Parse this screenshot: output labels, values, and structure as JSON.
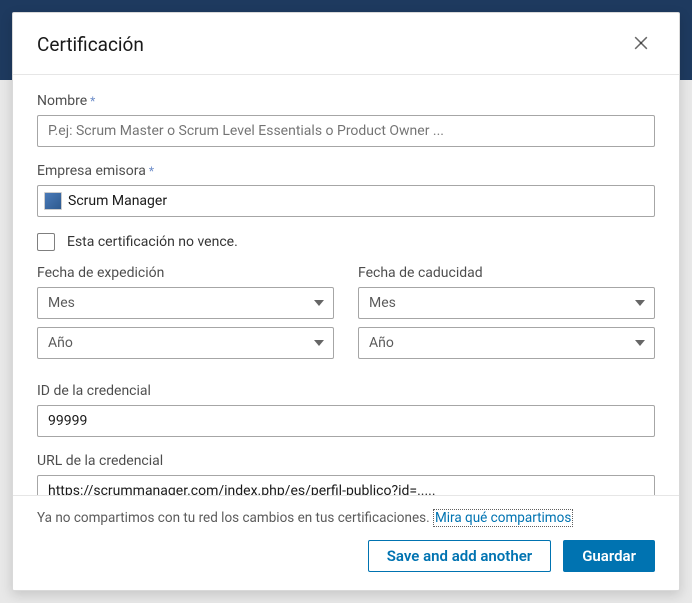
{
  "modal": {
    "title": "Certificación"
  },
  "fields": {
    "name": {
      "label": "Nombre",
      "placeholder": "P.ej: Scrum Master o Scrum Level Essentials o Product Owner ..."
    },
    "issuer": {
      "label": "Empresa emisora",
      "value": "Scrum Manager"
    },
    "no_expiry": {
      "label": "Esta certificación no vence."
    },
    "issue_date": {
      "label": "Fecha de expedición",
      "month": "Mes",
      "year": "Año"
    },
    "expiry_date": {
      "label": "Fecha de caducidad",
      "month": "Mes",
      "year": "Año"
    },
    "credential_id": {
      "label": "ID de la credencial",
      "value": "99999"
    },
    "credential_url": {
      "label": "URL de la credencial",
      "value": "https://scrummanager.com/index.php/es/perfil-publico?id=....."
    }
  },
  "info": {
    "text": "Ya no compartimos con tu red los cambios en tus certificaciones. ",
    "link_text": "Mira qué compartimos"
  },
  "footer": {
    "secondary": "Save and add another",
    "primary": "Guardar"
  }
}
